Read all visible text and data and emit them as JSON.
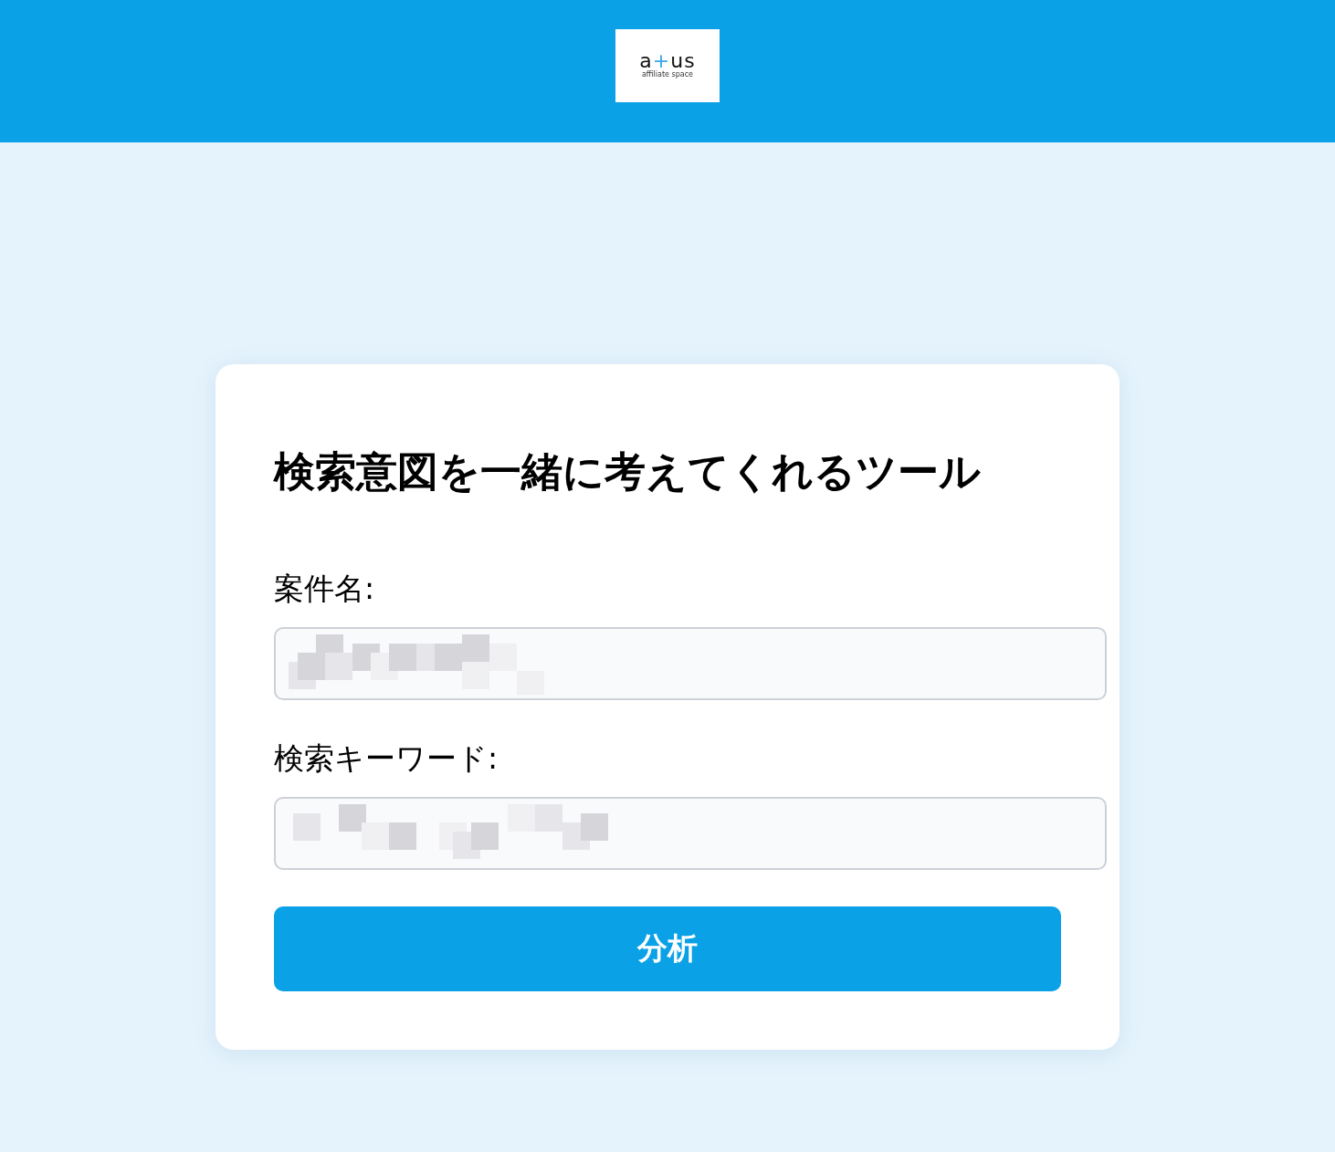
{
  "header": {
    "logo": {
      "parts": [
        {
          "text": "a",
          "kind": "plain"
        },
        {
          "text": "+",
          "kind": "accent"
        },
        {
          "text": "us",
          "kind": "plain"
        }
      ],
      "tagline": "affiliate space"
    }
  },
  "form": {
    "title": "検索意図を一緒に考えてくれるツール",
    "fields": [
      {
        "label": "案件名:",
        "redacted": true
      },
      {
        "label": "検索キーワード:",
        "redacted": true
      }
    ],
    "button": "分析"
  }
}
